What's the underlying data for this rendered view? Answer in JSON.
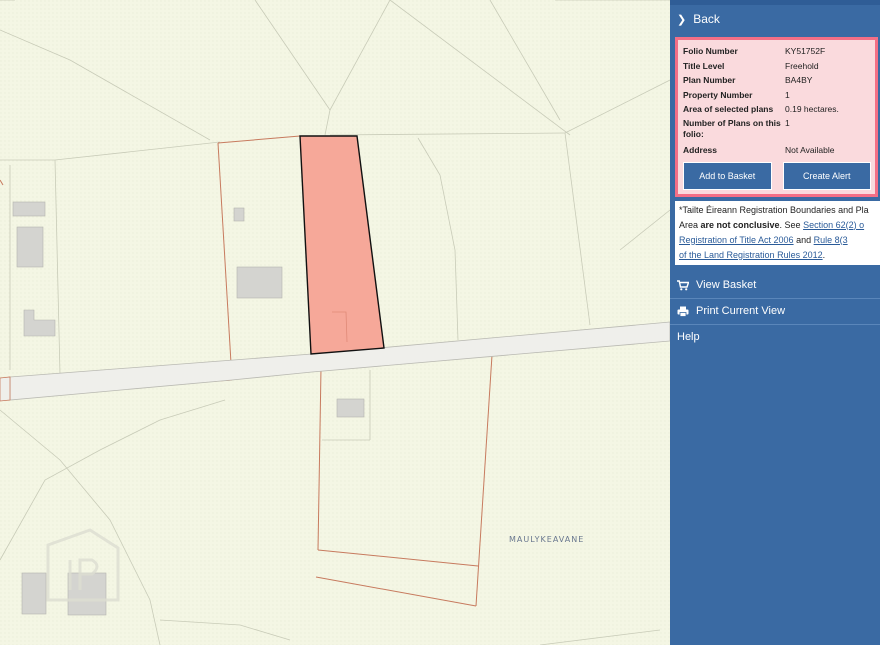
{
  "map": {
    "townland_label": "MAULYKEAVANE",
    "colors": {
      "background": "#f5f6e6",
      "boundary": "#c77a5e",
      "selected_fill": "#f6a899",
      "selected_stroke": "#111111",
      "road": "#eeeeea",
      "building": "#d4d4d0"
    }
  },
  "sidebar": {
    "back_label": "Back",
    "info": {
      "rows": [
        {
          "key": "Folio Number",
          "value": "KY51752F"
        },
        {
          "key": "Title Level",
          "value": "Freehold"
        },
        {
          "key": "Plan Number",
          "value": "BA4BY"
        },
        {
          "key": "Property Number",
          "value": "1"
        },
        {
          "key": "Area of selected plans",
          "value": "0.19 hectares."
        },
        {
          "key": "Number of Plans on this folio:",
          "value": "1"
        },
        {
          "key": "Address",
          "value": "Not Available"
        }
      ],
      "add_to_basket": "Add to Basket",
      "create_alert": "Create Alert"
    },
    "disclaimer": {
      "line1": "*Tailte Éireann Registration Boundaries and Pla",
      "line2_pre": "Area ",
      "line2_bold": "are not conclusive",
      "line2_post": ". See ",
      "link1a": "Section 62(2) o",
      "link1b": "Registration of Title Act 2006",
      "and": " and ",
      "link2a": "Rule 8(3",
      "link2b": "of the Land Registration Rules 2012",
      "end": "."
    },
    "menu": {
      "view_basket": "View Basket",
      "print_view": "Print Current View",
      "help": "Help"
    },
    "colors": {
      "panel": "#3a6aa3",
      "info_bg": "#fadadd",
      "info_border": "#f36f86"
    }
  }
}
